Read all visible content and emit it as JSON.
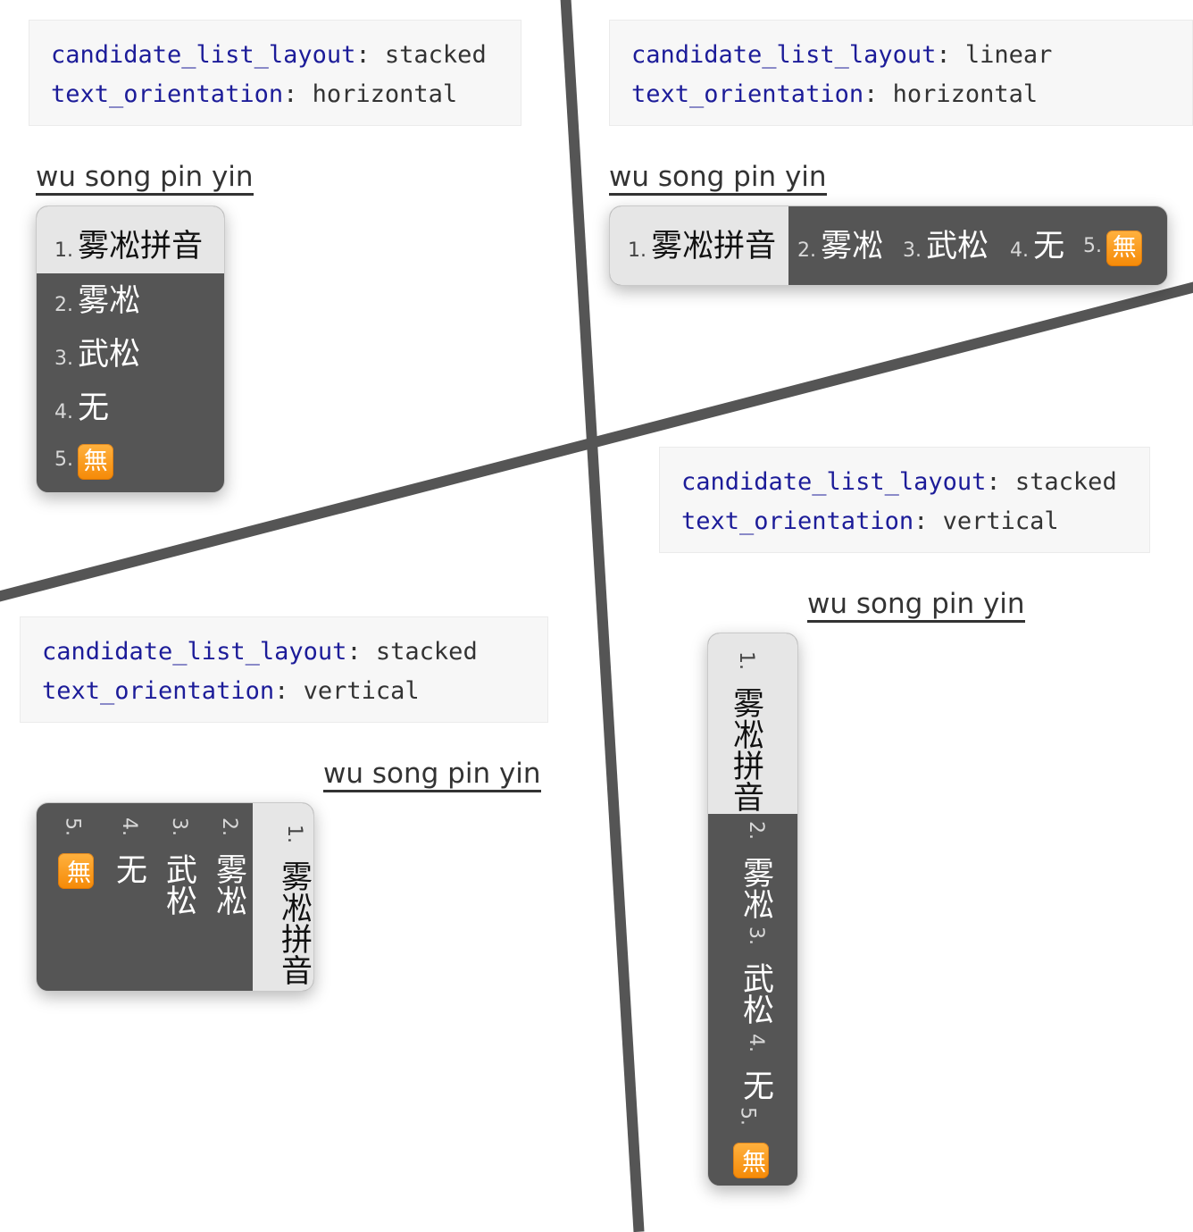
{
  "config_key_layout": "candidate_list_layout",
  "config_key_orientation": "text_orientation",
  "separator": ":",
  "panels": [
    {
      "layout": "stacked",
      "orientation": "horizontal",
      "preedit": "wu song pin yin"
    },
    {
      "layout": "linear",
      "orientation": "horizontal",
      "preedit": "wu song pin yin"
    },
    {
      "layout": "stacked",
      "orientation": "vertical",
      "preedit": "wu song pin yin"
    },
    {
      "layout": "stacked",
      "orientation": "vertical",
      "preedit": "wu song pin yin"
    }
  ],
  "candidates": [
    {
      "num": "1.",
      "text": "雾凇拼音"
    },
    {
      "num": "2.",
      "text": "雾凇"
    },
    {
      "num": "3.",
      "text": "武松"
    },
    {
      "num": "4.",
      "text": "无"
    },
    {
      "num": "5.",
      "text": "無"
    }
  ],
  "colors": {
    "panel_bg": "#555555",
    "selected_bg": "#e6e6e6",
    "key_color": "#1c1c99",
    "badge": "#f58a07"
  }
}
